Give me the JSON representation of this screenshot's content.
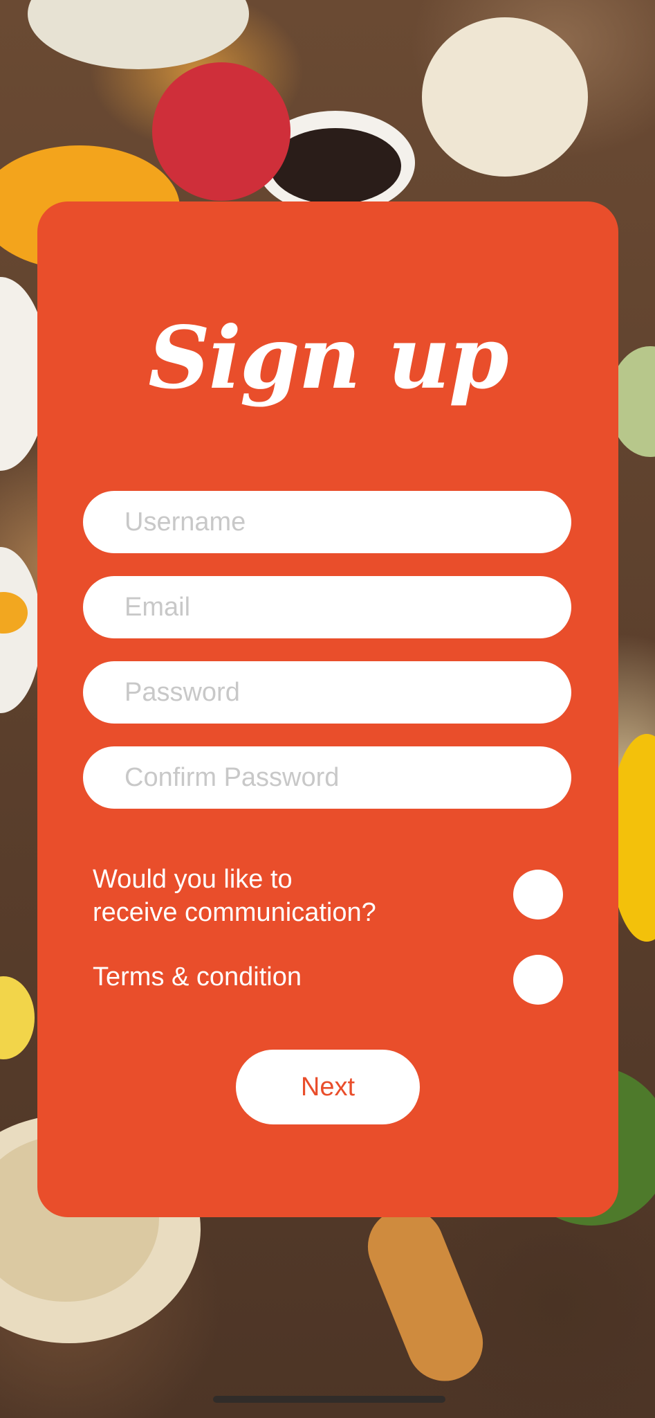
{
  "signup": {
    "title": "Sign up",
    "username_placeholder": "Username",
    "email_placeholder": "Email",
    "password_placeholder": "Password",
    "confirm_password_placeholder": "Confirm Password",
    "communication_label": "Would you like to\nreceive communication?",
    "terms_label": "Terms & condition",
    "next_label": "Next"
  },
  "colors": {
    "card": "#e94e2b",
    "field": "#ffffff",
    "placeholder": "#c8c8c8"
  },
  "background": {
    "image": "food-platter-photo"
  }
}
